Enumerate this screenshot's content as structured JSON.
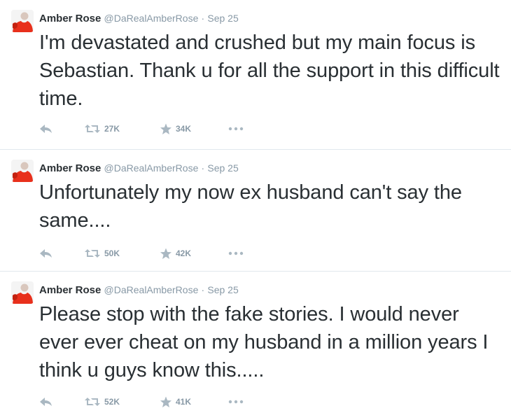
{
  "tweets": [
    {
      "name": "Amber Rose",
      "handle": "@DaRealAmberRose",
      "separator": "·",
      "time": "Sep 25",
      "text": "I'm devastated and crushed but my main focus is Sebastian. Thank u for all the support in this difficult time.",
      "retweets": "27K",
      "favorites": "34K"
    },
    {
      "name": "Amber Rose",
      "handle": "@DaRealAmberRose",
      "separator": "·",
      "time": "Sep 25",
      "text": "Unfortunately my now ex husband can't say the same....",
      "retweets": "50K",
      "favorites": "42K"
    },
    {
      "name": "Amber Rose",
      "handle": "@DaRealAmberRose",
      "separator": "·",
      "time": "Sep 25",
      "text": "Please stop with the fake stories. I would never ever ever cheat on my husband in a million years I think u guys know this.....",
      "retweets": "52K",
      "favorites": "41K"
    }
  ],
  "icons": {
    "reply": "reply-icon",
    "retweet": "retweet-icon",
    "favorite": "star-icon",
    "more": "more-icon"
  },
  "colors": {
    "text": "#292f33",
    "muted": "#8899a6",
    "icon": "#aab8c2",
    "divider": "#e1e8ed",
    "avatar_red": "#e8301c"
  }
}
